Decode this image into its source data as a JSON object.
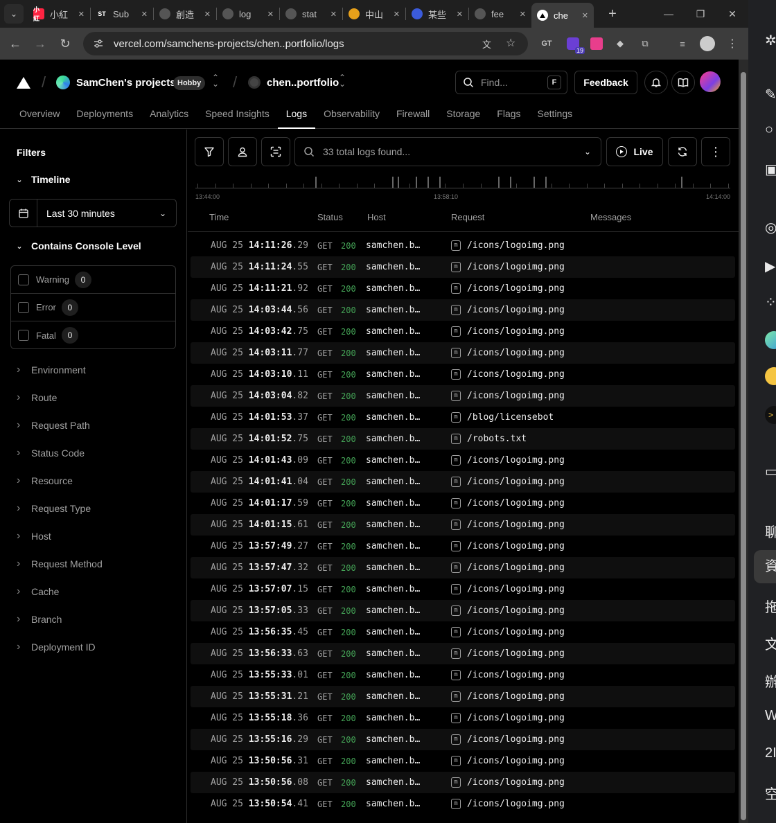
{
  "browser": {
    "tabs": [
      {
        "title": "小紅",
        "fav": "小紅",
        "color": "#ff2442"
      },
      {
        "title": "Sub",
        "fav": "ST",
        "color": "#1f1f1f"
      },
      {
        "title": "創造",
        "fav": "",
        "color": "#555"
      },
      {
        "title": "log",
        "fav": "",
        "color": "#555"
      },
      {
        "title": "stat",
        "fav": "",
        "color": "#555"
      },
      {
        "title": "中山",
        "fav": "",
        "color": "#e8a11a"
      },
      {
        "title": "某些",
        "fav": "",
        "color": "#3b5bdb"
      },
      {
        "title": "fee",
        "fav": "",
        "color": "#555"
      },
      {
        "title": "che",
        "fav": "",
        "color": "#000"
      }
    ],
    "url": "vercel.com/samchens-projects/chen..portfolio/logs",
    "ext_badge": "19"
  },
  "header": {
    "team_name": "SamChen's projects",
    "plan_badge": "Hobby",
    "project_name": "chen..portfolio",
    "find_placeholder": "Find...",
    "find_kbd": "F",
    "feedback_label": "Feedback",
    "nav": [
      "Overview",
      "Deployments",
      "Analytics",
      "Speed Insights",
      "Logs",
      "Observability",
      "Firewall",
      "Storage",
      "Flags",
      "Settings"
    ]
  },
  "sidebar": {
    "title": "Filters",
    "timeline_label": "Timeline",
    "range_value": "Last 30 minutes",
    "console_label": "Contains Console Level",
    "levels": [
      {
        "label": "Warning",
        "count": "0"
      },
      {
        "label": "Error",
        "count": "0"
      },
      {
        "label": "Fatal",
        "count": "0"
      }
    ],
    "filters": [
      "Environment",
      "Route",
      "Request Path",
      "Status Code",
      "Resource",
      "Request Type",
      "Host",
      "Request Method",
      "Cache",
      "Branch",
      "Deployment ID"
    ]
  },
  "main": {
    "search_text": "33 total logs found...",
    "live_label": "Live",
    "timeline_labels": [
      "13:44:00",
      "13:58:10",
      "14:14:00"
    ],
    "columns": [
      "Time",
      "Status",
      "Host",
      "Request",
      "Messages"
    ],
    "logs": [
      {
        "date": "AUG 25",
        "time": "14:11:26",
        "ms": ".29",
        "method": "GET",
        "status": "200",
        "host": "samchen.b…",
        "type": "m",
        "path": "/icons/logoimg.png"
      },
      {
        "date": "AUG 25",
        "time": "14:11:24",
        "ms": ".55",
        "method": "GET",
        "status": "200",
        "host": "samchen.b…",
        "type": "m",
        "path": "/icons/logoimg.png"
      },
      {
        "date": "AUG 25",
        "time": "14:11:21",
        "ms": ".92",
        "method": "GET",
        "status": "200",
        "host": "samchen.b…",
        "type": "m",
        "path": "/icons/logoimg.png"
      },
      {
        "date": "AUG 25",
        "time": "14:03:44",
        "ms": ".56",
        "method": "GET",
        "status": "200",
        "host": "samchen.b…",
        "type": "m",
        "path": "/icons/logoimg.png"
      },
      {
        "date": "AUG 25",
        "time": "14:03:42",
        "ms": ".75",
        "method": "GET",
        "status": "200",
        "host": "samchen.b…",
        "type": "m",
        "path": "/icons/logoimg.png"
      },
      {
        "date": "AUG 25",
        "time": "14:03:11",
        "ms": ".77",
        "method": "GET",
        "status": "200",
        "host": "samchen.b…",
        "type": "m",
        "path": "/icons/logoimg.png"
      },
      {
        "date": "AUG 25",
        "time": "14:03:10",
        "ms": ".11",
        "method": "GET",
        "status": "200",
        "host": "samchen.b…",
        "type": "m",
        "path": "/icons/logoimg.png"
      },
      {
        "date": "AUG 25",
        "time": "14:03:04",
        "ms": ".82",
        "method": "GET",
        "status": "200",
        "host": "samchen.b…",
        "type": "m",
        "path": "/icons/logoimg.png"
      },
      {
        "date": "AUG 25",
        "time": "14:01:53",
        "ms": ".37",
        "method": "GET",
        "status": "200",
        "host": "samchen.b…",
        "type": "m",
        "path": "/blog/licensebot"
      },
      {
        "date": "AUG 25",
        "time": "14:01:52",
        "ms": ".75",
        "method": "GET",
        "status": "200",
        "host": "samchen.b…",
        "type": "m",
        "path": "/robots.txt"
      },
      {
        "date": "AUG 25",
        "time": "14:01:43",
        "ms": ".09",
        "method": "GET",
        "status": "200",
        "host": "samchen.b…",
        "type": "m",
        "path": "/icons/logoimg.png"
      },
      {
        "date": "AUG 25",
        "time": "14:01:41",
        "ms": ".04",
        "method": "GET",
        "status": "200",
        "host": "samchen.b…",
        "type": "m",
        "path": "/icons/logoimg.png"
      },
      {
        "date": "AUG 25",
        "time": "14:01:17",
        "ms": ".59",
        "method": "GET",
        "status": "200",
        "host": "samchen.b…",
        "type": "m",
        "path": "/icons/logoimg.png"
      },
      {
        "date": "AUG 25",
        "time": "14:01:15",
        "ms": ".61",
        "method": "GET",
        "status": "200",
        "host": "samchen.b…",
        "type": "m",
        "path": "/icons/logoimg.png"
      },
      {
        "date": "AUG 25",
        "time": "13:57:49",
        "ms": ".27",
        "method": "GET",
        "status": "200",
        "host": "samchen.b…",
        "type": "m",
        "path": "/icons/logoimg.png"
      },
      {
        "date": "AUG 25",
        "time": "13:57:47",
        "ms": ".32",
        "method": "GET",
        "status": "200",
        "host": "samchen.b…",
        "type": "m",
        "path": "/icons/logoimg.png"
      },
      {
        "date": "AUG 25",
        "time": "13:57:07",
        "ms": ".15",
        "method": "GET",
        "status": "200",
        "host": "samchen.b…",
        "type": "m",
        "path": "/icons/logoimg.png"
      },
      {
        "date": "AUG 25",
        "time": "13:57:05",
        "ms": ".33",
        "method": "GET",
        "status": "200",
        "host": "samchen.b…",
        "type": "m",
        "path": "/icons/logoimg.png"
      },
      {
        "date": "AUG 25",
        "time": "13:56:35",
        "ms": ".45",
        "method": "GET",
        "status": "200",
        "host": "samchen.b…",
        "type": "m",
        "path": "/icons/logoimg.png"
      },
      {
        "date": "AUG 25",
        "time": "13:56:33",
        "ms": ".63",
        "method": "GET",
        "status": "200",
        "host": "samchen.b…",
        "type": "m",
        "path": "/icons/logoimg.png"
      },
      {
        "date": "AUG 25",
        "time": "13:55:33",
        "ms": ".01",
        "method": "GET",
        "status": "200",
        "host": "samchen.b…",
        "type": "m",
        "path": "/icons/logoimg.png"
      },
      {
        "date": "AUG 25",
        "time": "13:55:31",
        "ms": ".21",
        "method": "GET",
        "status": "200",
        "host": "samchen.b…",
        "type": "m",
        "path": "/icons/logoimg.png"
      },
      {
        "date": "AUG 25",
        "time": "13:55:18",
        "ms": ".36",
        "method": "GET",
        "status": "200",
        "host": "samchen.b…",
        "type": "m",
        "path": "/icons/logoimg.png"
      },
      {
        "date": "AUG 25",
        "time": "13:55:16",
        "ms": ".29",
        "method": "GET",
        "status": "200",
        "host": "samchen.b…",
        "type": "m",
        "path": "/icons/logoimg.png"
      },
      {
        "date": "AUG 25",
        "time": "13:50:56",
        "ms": ".31",
        "method": "GET",
        "status": "200",
        "host": "samchen.b…",
        "type": "m",
        "path": "/icons/logoimg.png"
      },
      {
        "date": "AUG 25",
        "time": "13:50:56",
        "ms": ".08",
        "method": "GET",
        "status": "200",
        "host": "samchen.b…",
        "type": "m",
        "path": "/icons/logoimg.png"
      },
      {
        "date": "AUG 25",
        "time": "13:50:54",
        "ms": ".41",
        "method": "GET",
        "status": "200",
        "host": "samchen.b…",
        "type": "m",
        "path": "/icons/logoimg.png"
      }
    ]
  },
  "side_panel": {
    "labels": [
      "聊",
      "資",
      "拖",
      "文",
      "辦",
      "W",
      "2I",
      "空"
    ]
  },
  "colors": {
    "success": "#45a557",
    "bg": "#000000",
    "border": "#2e2e2e"
  }
}
